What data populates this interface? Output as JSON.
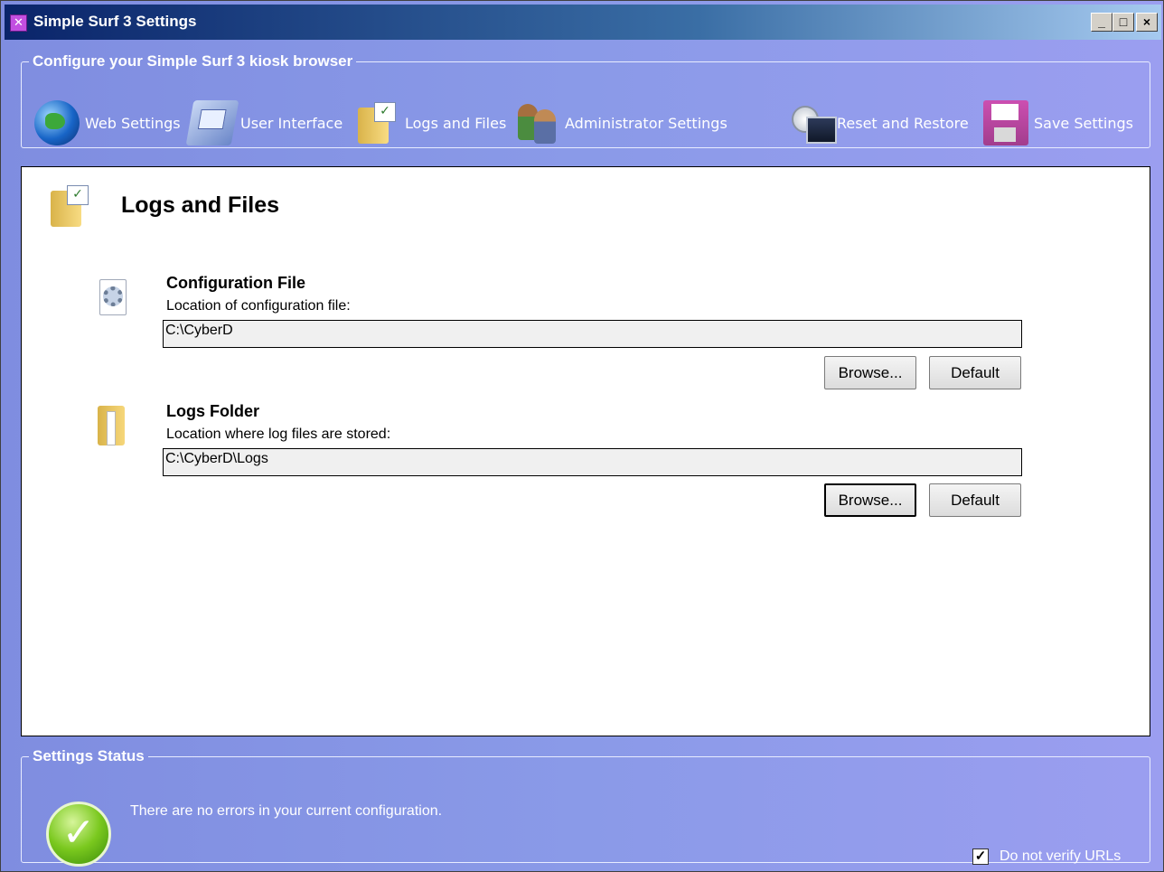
{
  "window": {
    "title": "Simple Surf 3 Settings",
    "controls": {
      "minimize": "_",
      "maximize": "□",
      "close": "×"
    }
  },
  "config_group": {
    "legend": "Configure your Simple Surf 3 kiosk browser",
    "items": [
      {
        "label": "Web Settings",
        "icon": "globe-icon"
      },
      {
        "label": "User Interface",
        "icon": "user-interface-icon"
      },
      {
        "label": "Logs and Files",
        "icon": "folder-checklist-icon"
      },
      {
        "label": "Administrator Settings",
        "icon": "admin-users-icon"
      },
      {
        "label": "Reset and Restore",
        "icon": "reset-restore-icon"
      },
      {
        "label": "Save Settings",
        "icon": "floppy-disk-icon"
      }
    ]
  },
  "page": {
    "title": "Logs and Files",
    "sections": [
      {
        "title": "Configuration File",
        "description": "Location of configuration file:",
        "value": "C:\\CyberD",
        "browse_label": "Browse...",
        "default_label": "Default"
      },
      {
        "title": "Logs Folder",
        "description": "Location where log files are stored:",
        "value": "C:\\CyberD\\Logs",
        "browse_label": "Browse...",
        "default_label": "Default"
      }
    ]
  },
  "status": {
    "legend": "Settings Status",
    "message": "There are no errors in your current configuration.",
    "verify_label": "Do not verify URLs",
    "verify_checked": true
  },
  "colors": {
    "panel_gradient_start": "#7f8de0",
    "panel_gradient_end": "#9b9ef0",
    "title_bar": "#0a246a"
  }
}
